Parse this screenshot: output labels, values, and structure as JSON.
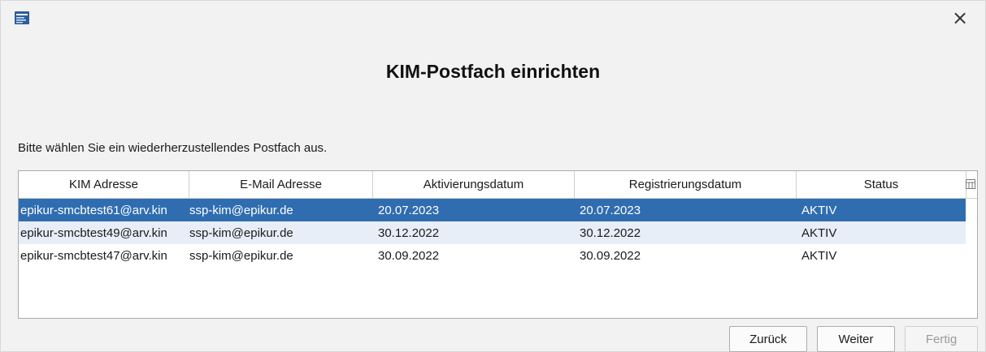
{
  "window": {
    "icon": "app-icon",
    "close_label": "×"
  },
  "title": "KIM-Postfach einrichten",
  "instruction": "Bitte wählen Sie ein wiederherzustellendes Postfach aus.",
  "table": {
    "columns": [
      "KIM Adresse",
      "E-Mail Adresse",
      "Aktivierungsdatum",
      "Registrierungsdatum",
      "Status"
    ],
    "column_config_icon": "column-config-icon",
    "rows": [
      {
        "kim": "epikur-smcbtest61@arv.kin",
        "email": "ssp-kim@epikur.de",
        "aktivierung": "20.07.2023",
        "registrierung": "20.07.2023",
        "status": "AKTIV",
        "selected": true
      },
      {
        "kim": "epikur-smcbtest49@arv.kin",
        "email": "ssp-kim@epikur.de",
        "aktivierung": "30.12.2022",
        "registrierung": "30.12.2022",
        "status": "AKTIV",
        "selected": false
      },
      {
        "kim": "epikur-smcbtest47@arv.kin",
        "email": "ssp-kim@epikur.de",
        "aktivierung": "30.09.2022",
        "registrierung": "30.09.2022",
        "status": "AKTIV",
        "selected": false
      }
    ]
  },
  "buttons": {
    "back": "Zurück",
    "next": "Weiter",
    "finish": "Fertig"
  },
  "colors": {
    "selection": "#2f6db0",
    "alt_row": "#e8eef8",
    "disabled_text": "#9a9a9a"
  }
}
